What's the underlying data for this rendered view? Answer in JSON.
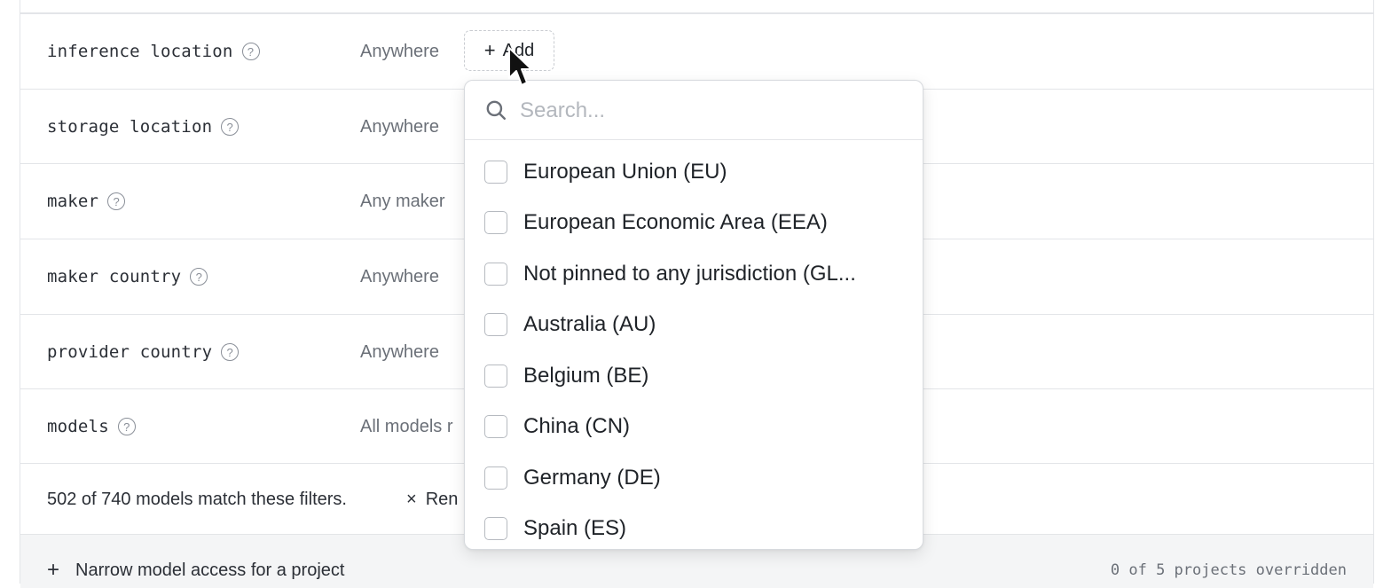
{
  "rows": [
    {
      "label": "inference location",
      "value": "Anywhere"
    },
    {
      "label": "storage location",
      "value": "Anywhere"
    },
    {
      "label": "maker",
      "value": "Any maker"
    },
    {
      "label": "maker country",
      "value": "Anywhere"
    },
    {
      "label": "provider country",
      "value": "Anywhere"
    },
    {
      "label": "models",
      "value": "All models r"
    }
  ],
  "help_glyph": "?",
  "add_button": {
    "plus": "+",
    "label": "Add"
  },
  "summary": {
    "text": "502 of 740 models match these filters.",
    "remove_icon": "×",
    "remove_label": "Ren"
  },
  "footer": {
    "plus": "+",
    "narrow_label": "Narrow model access for a project",
    "count": "0 of 5 projects overridden"
  },
  "dropdown": {
    "search_placeholder": "Search...",
    "search_value": "",
    "options": [
      "European Union (EU)",
      "European Economic Area (EEA)",
      "Not pinned to any jurisdiction (GL...",
      "Australia (AU)",
      "Belgium (BE)",
      "China (CN)",
      "Germany (DE)",
      "Spain (ES)"
    ]
  },
  "icons": {
    "search": "search-icon",
    "help": "help-circle-icon",
    "cursor": "mouse-pointer-icon"
  }
}
